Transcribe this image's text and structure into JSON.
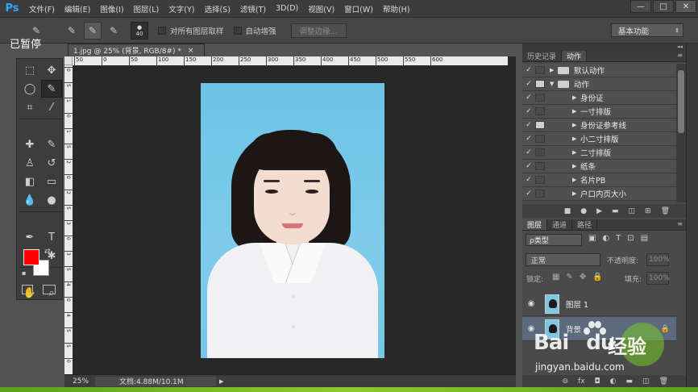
{
  "app": {
    "logo": "Ps"
  },
  "menu": [
    "文件(F)",
    "编辑(E)",
    "图像(I)",
    "图层(L)",
    "文字(Y)",
    "选择(S)",
    "滤镜(T)",
    "3D(D)",
    "视图(V)",
    "窗口(W)",
    "帮助(H)"
  ],
  "window_controls": {
    "minimize": "—",
    "maximize": "□",
    "close": "✕"
  },
  "overlay_text": "已暂停",
  "options": {
    "brush_size": "40",
    "sample_all_layers": "对所有图层取样",
    "auto_enhance": "自动增强",
    "refine_edge": "调整边缘...",
    "workspace": "基本功能"
  },
  "document": {
    "tab_title": "1.jpg @ 25% (背景, RGB/8#) *",
    "tab_close": "×",
    "ruler_ticks": [
      "50",
      "0",
      "50",
      "100",
      "150",
      "200",
      "250",
      "300",
      "350",
      "400",
      "450",
      "500",
      "550",
      "600"
    ],
    "ruler_v_ticks": [
      "0",
      "5",
      "1",
      "0",
      "1",
      "5",
      "2",
      "0",
      "2",
      "5",
      "3",
      "0",
      "3",
      "5",
      "4",
      "0",
      "4",
      "5",
      "5",
      "0"
    ]
  },
  "status": {
    "zoom": "25%",
    "doc_info": "文档:4.88M/10.1M",
    "arrow": "▶"
  },
  "history_panel": {
    "tabs": [
      "历史记录",
      "动作"
    ],
    "active_tab": 1,
    "actions": [
      {
        "label": "默认动作",
        "type": "set",
        "checked": true,
        "dialog": false,
        "expanded": false
      },
      {
        "label": "动作",
        "type": "set",
        "checked": true,
        "dialog": true,
        "expanded": true
      },
      {
        "label": "身份证",
        "type": "action",
        "checked": true,
        "dialog": false
      },
      {
        "label": "一寸排版",
        "type": "action",
        "checked": true,
        "dialog": false
      },
      {
        "label": "身份证参考线",
        "type": "action",
        "checked": true,
        "dialog": true
      },
      {
        "label": "小二寸排版",
        "type": "action",
        "checked": true,
        "dialog": false
      },
      {
        "label": "二寸排版",
        "type": "action",
        "checked": true,
        "dialog": false
      },
      {
        "label": "纸条",
        "type": "action",
        "checked": true,
        "dialog": false
      },
      {
        "label": "名片PB",
        "type": "action",
        "checked": true,
        "dialog": false
      },
      {
        "label": "户口内页大小",
        "type": "action",
        "checked": true,
        "dialog": false
      }
    ],
    "toolbar": [
      "■",
      "●",
      "▶",
      "▬",
      "◫",
      "⊞",
      "🗑"
    ]
  },
  "layers_panel": {
    "tabs": [
      "图层",
      "通道",
      "路径"
    ],
    "active_tab": 0,
    "filter": "ρ类型",
    "blend_mode": "正常",
    "opacity_label": "不透明度:",
    "opacity_value": "100%",
    "lock_label": "锁定:",
    "fill_label": "填充:",
    "fill_value": "100%",
    "layers": [
      {
        "name": "图层 1",
        "selected": false,
        "locked": false
      },
      {
        "name": "背景",
        "selected": true,
        "locked": true
      }
    ],
    "toolbar": [
      "⊖",
      "fx",
      "◘",
      "◐",
      "▬",
      "◫",
      "🗑"
    ]
  },
  "watermark": {
    "brand_left": "Bai",
    "brand_du": "du",
    "brand_right": "经验",
    "url": "jingyan.baidu.com"
  },
  "colors": {
    "foreground": "#ff0000",
    "background": "#ffffff",
    "ps_blue": "#31a8ff"
  }
}
